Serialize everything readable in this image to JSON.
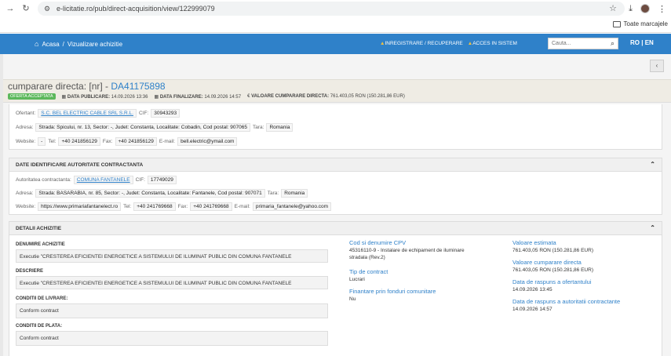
{
  "browser": {
    "url": "e-licitatie.ro/pub/direct-acquisition/view/122999079",
    "bookmarks_label": "Toate marcajele"
  },
  "header": {
    "home": "Acasa",
    "separator": "/",
    "breadcrumb_current": "Vizualizare achizitie",
    "link_register": "INREGISTRARE / RECUPERARE",
    "link_access": "ACCES IN SISTEM",
    "search_placeholder": "Cauta...",
    "lang_ro": "RO",
    "lang_sep": "|",
    "lang_en": "EN"
  },
  "title_bar": {
    "title_prefix": "cumparare directa: [nr] - ",
    "code": "DA41175898",
    "status_badge": "OFERTA ACCEPTATA",
    "publish_label": "DATA PUBLICARE:",
    "publish_date": "14.09.2026 13:36",
    "finalize_label": "DATA FINALIZARE:",
    "finalize_date": "14.09.2026 14:57",
    "value_label": "VALOARE CUMPARARE DIRECTA:",
    "value": "761.403,05 RON (150.281,86 EUR)",
    "value_prefix": "€"
  },
  "bidder": {
    "ofertant_label": "Ofertant:",
    "ofertant": "S.C. BEL ELECTRIC CABLE SRL S.R.L.",
    "cif_label": "CIF:",
    "cif": "30943293",
    "address_label": "Adresa:",
    "address": "Strada: Spicului, nr. 13, Sector: -, Judet: Constanta, Localitate: Cobadin, Cod postal: 907065",
    "country_label": "Tara:",
    "country": "Romania",
    "website_label": "Website:",
    "website": "-",
    "tel_label": "Tel:",
    "tel": "+40 241856129",
    "fax_label": "Fax:",
    "fax": "+40 241856129",
    "email_label": "E-mail:",
    "email": "bell.electric@ymail.com"
  },
  "authority": {
    "heading": "DATE IDENTIFICARE AUTORITATE CONTRACTANTA",
    "authority_label": "Autoritatea contractanta:",
    "authority": "COMUNA FANTANELE",
    "cif_label": "CIF:",
    "cif": "17749029",
    "address_label": "Adresa:",
    "address": "Strada: BASARABIA, nr. 85, Sector: -, Judet: Constanta, Localitate: Fantanele, Cod postal: 907071",
    "country_label": "Tara:",
    "country": "Romania",
    "website_label": "Website:",
    "website": "https://www.primariafantanelect.ro",
    "tel_label": "Tel:",
    "tel": "+40 241769668",
    "fax_label": "Fax:",
    "fax": "+40 241769668",
    "email_label": "E-mail:",
    "email": "primaria_fantanele@yahoo.com"
  },
  "details": {
    "heading": "DETALII ACHIZITIE",
    "name_label": "DENUMIRE ACHIZITIE",
    "name": "Executie \"CRESTEREA EFICIENTEI ENERGETICE A SISTEMULUI DE ILUMINAT PUBLIC DIN COMUNA FANTANELE",
    "desc_label": "DESCRIERE",
    "desc": "Executie \"CRESTEREA EFICIENTEI ENERGETICE A SISTEMULUI DE ILUMINAT PUBLIC DIN COMUNA FANTANELE",
    "delivery_label": "CONDITII DE LIVRARE:",
    "delivery": "Conform contract",
    "payment_label": "CONDITII DE PLATA:",
    "payment": "Conform contract",
    "cpv_title": "Cod si denumire CPV",
    "cpv_line1": "45316110-9 - Instalare de echipament de iluminare",
    "cpv_line2": "stradala (Rev.2)",
    "contract_type_title": "Tip de contract",
    "contract_type": "Lucrari",
    "funds_title": "Finantare prin fonduri comunitare",
    "funds": "Nu",
    "est_value_title": "Valoare estimata",
    "est_value": "761.403,05 RON (150.281,86 EUR)",
    "direct_value_title": "Valoare cumparare directa",
    "direct_value": "761.403,05 RON (150.281,86 EUR)",
    "bidder_reply_title": "Data de raspuns a ofertantului",
    "bidder_reply": "14.09.2026 13:45",
    "authority_reply_title": "Data de raspuns a autoritatii contractante",
    "authority_reply": "14.09.2026 14:57"
  }
}
